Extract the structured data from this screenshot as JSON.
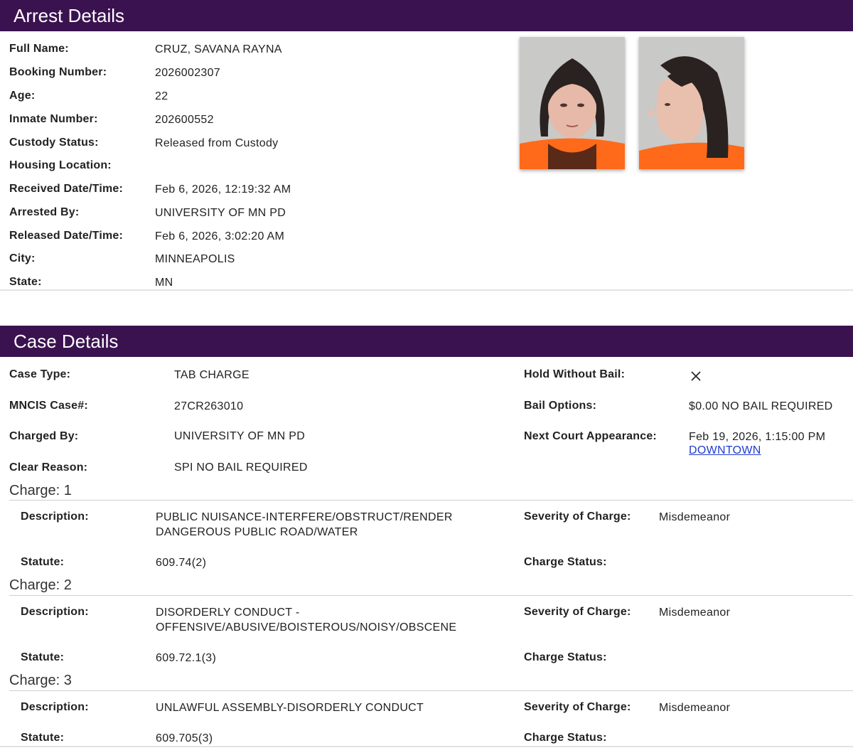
{
  "arrest": {
    "header": "Arrest Details",
    "fields": [
      {
        "label": "Full Name:",
        "value": "CRUZ, SAVANA RAYNA"
      },
      {
        "label": "Booking Number:",
        "value": "2026002307"
      },
      {
        "label": "Age:",
        "value": "22"
      },
      {
        "label": "Inmate Number:",
        "value": "202600552"
      },
      {
        "label": "Custody Status:",
        "value": "Released from Custody"
      },
      {
        "label": "Housing Location:",
        "value": ""
      },
      {
        "label": "Received Date/Time:",
        "value": "Feb 6, 2026, 12:19:32 AM"
      },
      {
        "label": "Arrested By:",
        "value": "UNIVERSITY OF MN PD"
      },
      {
        "label": "Released Date/Time:",
        "value": "Feb 6, 2026, 3:02:20 AM"
      },
      {
        "label": "City:",
        "value": "MINNEAPOLIS"
      },
      {
        "label": "State:",
        "value": "MN"
      }
    ]
  },
  "case": {
    "header": "Case Details",
    "left": [
      {
        "label": "Case Type:",
        "value": "TAB CHARGE"
      },
      {
        "label": "MNCIS Case#:",
        "value": "27CR263010"
      },
      {
        "label": "Charged By:",
        "value": "UNIVERSITY OF MN PD"
      },
      {
        "label": "Clear Reason:",
        "value": "SPI NO BAIL REQUIRED"
      }
    ],
    "hold_label": "Hold Without Bail:",
    "bail_label": "Bail Options:",
    "bail_value": "$0.00 NO BAIL REQUIRED",
    "court_label": "Next Court Appearance:",
    "court_value": "Feb 19, 2026, 1:15:00 PM",
    "court_link": "DOWNTOWN"
  },
  "charges": [
    {
      "title": "Charge: 1",
      "desc_label": "Description:",
      "desc_lines": [
        "PUBLIC NUISANCE-INTERFERE/OBSTRUCT/RENDER",
        "DANGEROUS PUBLIC ROAD/WATER"
      ],
      "severity_label": "Severity of Charge:",
      "severity": "Misdemeanor",
      "statute_label": "Statute:",
      "statute": "609.74(2)",
      "status_label": "Charge Status:"
    },
    {
      "title": "Charge: 2",
      "desc_label": "Description:",
      "desc_lines": [
        "DISORDERLY CONDUCT -",
        "OFFENSIVE/ABUSIVE/BOISTEROUS/NOISY/OBSCENE"
      ],
      "severity_label": "Severity of Charge:",
      "severity": "Misdemeanor",
      "statute_label": "Statute:",
      "statute": "609.72.1(3)",
      "status_label": "Charge Status:"
    },
    {
      "title": "Charge: 3",
      "desc_label": "Description:",
      "desc_lines": [
        "UNLAWFUL ASSEMBLY-DISORDERLY CONDUCT"
      ],
      "severity_label": "Severity of Charge:",
      "severity": "Misdemeanor",
      "statute_label": "Statute:",
      "statute": "609.705(3)",
      "status_label": "Charge Status:"
    }
  ],
  "icons": {
    "hold": "close-icon"
  },
  "colors": {
    "header_bg": "#3b1250",
    "link": "#1f3ccf"
  }
}
